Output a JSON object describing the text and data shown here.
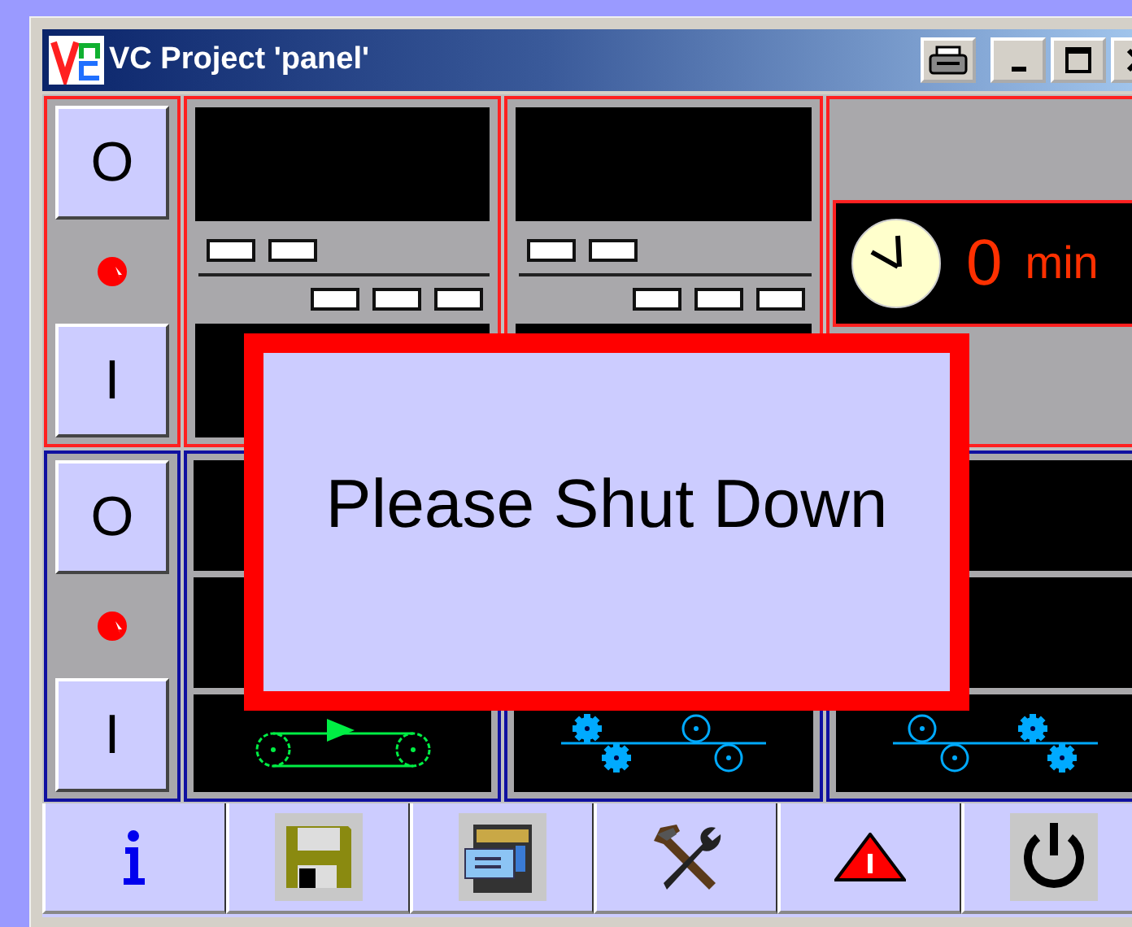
{
  "window": {
    "title": "VC Project 'panel'"
  },
  "upper_row": {
    "switch": {
      "off_label": "O",
      "on_label": "I"
    },
    "timer": {
      "value": "0",
      "unit": "min"
    }
  },
  "lower_row": {
    "switch": {
      "off_label": "O",
      "on_label": "I"
    },
    "conveyors": [
      {
        "kind": "belt"
      },
      {
        "kind": "rollers"
      },
      {
        "kind": "rollers_reversed"
      }
    ]
  },
  "dialog": {
    "message": "Please Shut Down"
  }
}
